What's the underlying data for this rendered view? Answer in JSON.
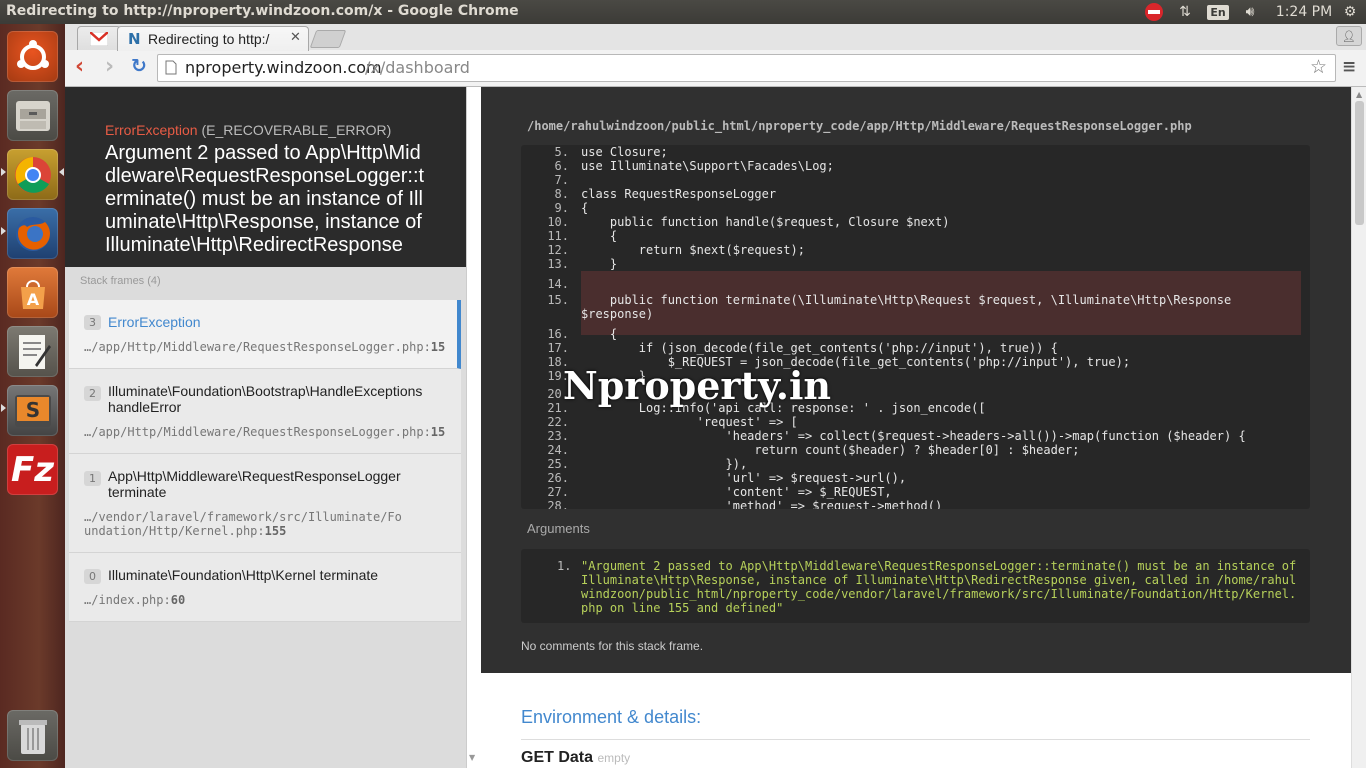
{
  "window": {
    "title": "Redirecting to http://nproperty.windzoon.com/x - Google Chrome"
  },
  "panel": {
    "clock": "1:24 PM",
    "keyboard": "En"
  },
  "launcher": {
    "items": [
      "ubuntu-dash",
      "files",
      "chrome",
      "firefox",
      "software-center",
      "text-editor",
      "sublime-text",
      "filezilla",
      "trash"
    ]
  },
  "browser": {
    "tabs": [
      {
        "label": "",
        "icon": "gmail-icon"
      },
      {
        "label": "Redirecting to http:/",
        "icon": "nproperty-icon"
      }
    ],
    "url_host": "nproperty.windzoon.com",
    "url_path": "/x/dashboard"
  },
  "error": {
    "type": "ErrorException",
    "code": "(E_RECOVERABLE_ERROR)",
    "message": "Argument 2 passed to App\\Http\\Middleware\\RequestResponseLogger::terminate() must be an instance of Illuminate\\Http\\Response, instance of Illuminate\\Http\\RedirectResponse"
  },
  "stack": {
    "header": "Stack frames (4)",
    "frames": [
      {
        "num": "3",
        "cls": "ErrorException",
        "path": "…/app/Http/Middleware/RequestResponseLogger.php",
        "line": "15"
      },
      {
        "num": "2",
        "cls": "Illuminate\\Foundation\\Bootstrap\\HandleExceptions handleError",
        "path": "…/app/Http/Middleware/RequestResponseLogger.php",
        "line": "15"
      },
      {
        "num": "1",
        "cls": "App\\Http\\Middleware\\RequestResponseLogger terminate",
        "path": "…/vendor/laravel/framework/src/Illuminate/Foundation/Http/Kernel.php",
        "line": "155"
      },
      {
        "num": "0",
        "cls": "Illuminate\\Foundation\\Http\\Kernel terminate",
        "path": "…/index.php",
        "line": "60"
      }
    ]
  },
  "code": {
    "file": "/home/rahulwindzoon/public_html/nproperty_code/app/Http/Middleware/RequestResponseLogger.php",
    "lines": [
      {
        "n": "5.",
        "t": "use Closure;"
      },
      {
        "n": "6.",
        "t": "use Illuminate\\Support\\Facades\\Log;"
      },
      {
        "n": "7.",
        "t": ""
      },
      {
        "n": "8.",
        "t": "class RequestResponseLogger"
      },
      {
        "n": "9.",
        "t": "{"
      },
      {
        "n": "10.",
        "t": "    public function handle($request, Closure $next)"
      },
      {
        "n": "11.",
        "t": "    {"
      },
      {
        "n": "12.",
        "t": "        return $next($request);"
      },
      {
        "n": "13.",
        "t": "    }"
      },
      {
        "n": "14.",
        "t": ""
      },
      {
        "n": "15.",
        "t": "    public function terminate(\\Illuminate\\Http\\Request $request, \\Illuminate\\Http\\Response"
      },
      {
        "n": "",
        "t": "$response)"
      },
      {
        "n": "16.",
        "t": "    {"
      },
      {
        "n": "17.",
        "t": "        if (json_decode(file_get_contents('php://input'), true)) {"
      },
      {
        "n": "18.",
        "t": "            $_REQUEST = json_decode(file_get_contents('php://input'), true);"
      },
      {
        "n": "19.",
        "t": "        }"
      },
      {
        "n": "20.",
        "t": ""
      },
      {
        "n": "21.",
        "t": "        Log::info('api call: response: ' . json_encode(["
      },
      {
        "n": "22.",
        "t": "                'request' => ["
      },
      {
        "n": "23.",
        "t": "                    'headers' => collect($request->headers->all())->map(function ($header) {"
      },
      {
        "n": "24.",
        "t": "                        return count($header) ? $header[0] : $header;"
      },
      {
        "n": "25.",
        "t": "                    }),"
      },
      {
        "n": "26.",
        "t": "                    'url' => $request->url(),"
      },
      {
        "n": "27.",
        "t": "                    'content' => $_REQUEST,"
      },
      {
        "n": "28.",
        "t": "                    'method' => $request->method()"
      }
    ]
  },
  "arguments": {
    "label": "Arguments",
    "items": [
      {
        "n": "1.",
        "t": "\"Argument 2 passed to App\\Http\\Middleware\\RequestResponseLogger::terminate() must be an instance of Illuminate\\Http\\Response, instance of Illuminate\\Http\\RedirectResponse given, called in /home/rahulwindzoon/public_html/nproperty_code/vendor/laravel/framework/src/Illuminate/Foundation/Http/Kernel.php on line 155 and defined\""
      }
    ]
  },
  "comments": "No comments for this stack frame.",
  "env": {
    "title": "Environment & details:",
    "get_label": "GET Data",
    "get_value": "empty"
  },
  "watermark": "Nproperty.in"
}
